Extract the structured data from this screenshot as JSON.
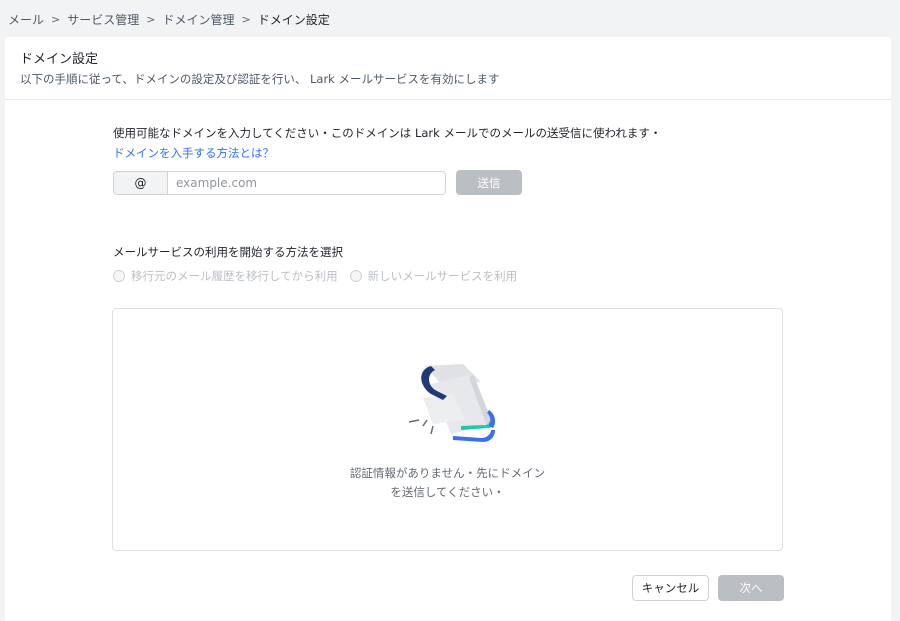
{
  "breadcrumb": {
    "items": [
      "メール",
      "サービス管理",
      "ドメイン管理",
      "ドメイン設定"
    ]
  },
  "header": {
    "title": "ドメイン設定",
    "subtitle": "以下の手順に従って、ドメインの設定及び認証を行い、 Lark メールサービスを有効にします"
  },
  "domain_section": {
    "label": "使用可能なドメインを入力してください・このドメインは Lark メールでのメールの送受信に使われます・",
    "help_link": "ドメインを入手する方法とは？",
    "prefix": "@",
    "input_value": "",
    "input_placeholder": "example.com",
    "send_label": "送信"
  },
  "method_section": {
    "label": "メールサービスの利用を開始する方法を選択",
    "options": [
      "移行元のメール履歴を移行してから利用",
      "新しいメールサービスを利用"
    ]
  },
  "empty_state": {
    "line1": "認証情報がありません・先にドメイン",
    "line2": "を送信してください・",
    "icon": "envelope-illustration-icon"
  },
  "footer": {
    "cancel_label": "キャンセル",
    "next_label": "次へ"
  },
  "colors": {
    "accent": "#3370ff",
    "disabled_button": "#bbbfc4",
    "page_bg": "#f2f3f5"
  }
}
